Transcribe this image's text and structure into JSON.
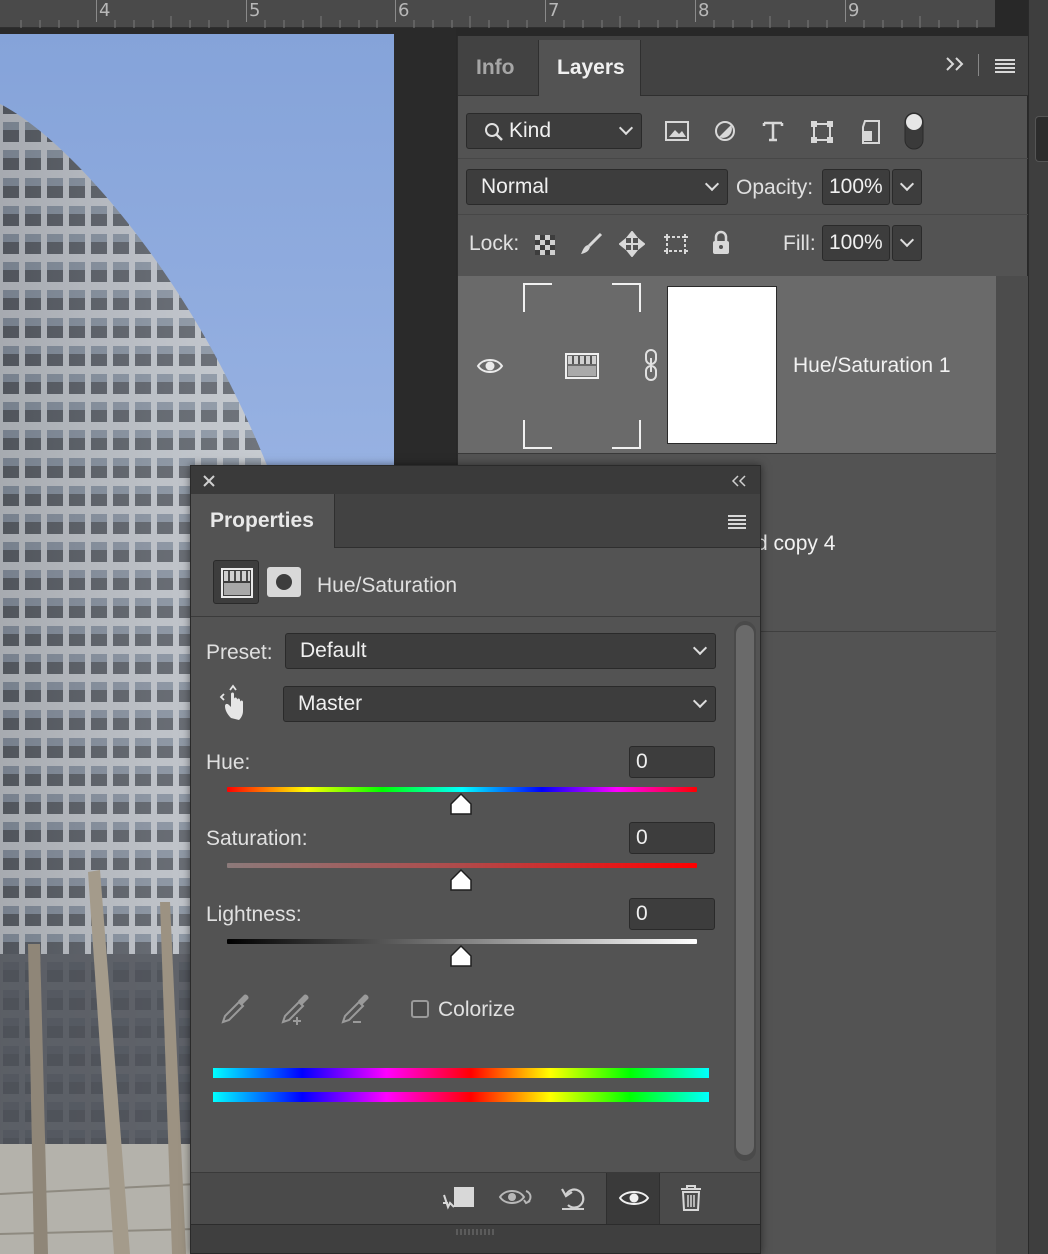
{
  "ruler": {
    "labels": [
      "4",
      "5",
      "6",
      "7",
      "8",
      "9"
    ]
  },
  "layers_panel": {
    "tabs": [
      {
        "label": "Info",
        "active": false
      },
      {
        "label": "Layers",
        "active": true
      }
    ],
    "filter": {
      "kind_label": "Kind",
      "filter_icons": [
        "image-filter-icon",
        "adjustment-filter-icon",
        "type-filter-icon",
        "shape-filter-icon",
        "smart-object-filter-icon",
        "filter-toggle-icon"
      ]
    },
    "blend_mode": "Normal",
    "opacity_label": "Opacity:",
    "opacity_value": "100%",
    "lock_label": "Lock:",
    "lock_icons": [
      "lock-transparent-icon",
      "lock-pixels-icon",
      "lock-position-icon",
      "lock-artboard-icon",
      "lock-all-icon"
    ],
    "fill_label": "Fill:",
    "fill_value": "100%",
    "layers": [
      {
        "name": "Hue/Saturation 1",
        "visible": true,
        "selected": true
      },
      {
        "name": "d copy 4",
        "visible": true,
        "selected": false
      }
    ]
  },
  "properties_panel": {
    "tab_label": "Properties",
    "adjustment_title": "Hue/Saturation",
    "preset_label": "Preset:",
    "preset_value": "Default",
    "channel_value": "Master",
    "hue_label": "Hue:",
    "hue_value": "0",
    "saturation_label": "Saturation:",
    "saturation_value": "0",
    "lightness_label": "Lightness:",
    "lightness_value": "0",
    "colorize_label": "Colorize",
    "colorize_checked": false,
    "footer_icons": [
      "clip-to-layer-icon",
      "view-previous-state-icon",
      "reset-icon",
      "visibility-icon",
      "delete-icon"
    ]
  }
}
